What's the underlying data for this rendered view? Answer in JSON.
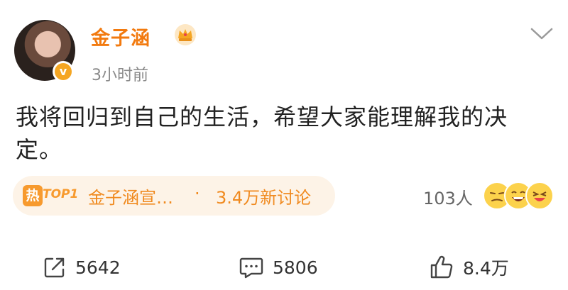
{
  "post": {
    "author": "金子涵",
    "time": "3小时前",
    "content": "我将回归到自己的生活，希望大家能理解我的决定。"
  },
  "topic": {
    "hot_label": "热",
    "badge": "TOP1",
    "title": "金子涵宣…",
    "separator": "·",
    "discussion": "3.4万新讨论"
  },
  "reactions": {
    "count": "103人",
    "emojis": [
      "smirk-emoji",
      "laugh-emoji",
      "grin-emoji"
    ]
  },
  "actions": {
    "share_count": "5642",
    "comment_count": "5806",
    "like_count": "8.4万"
  },
  "colors": {
    "accent": "#f27a0f",
    "topic_bg": "#fdf3e7"
  }
}
